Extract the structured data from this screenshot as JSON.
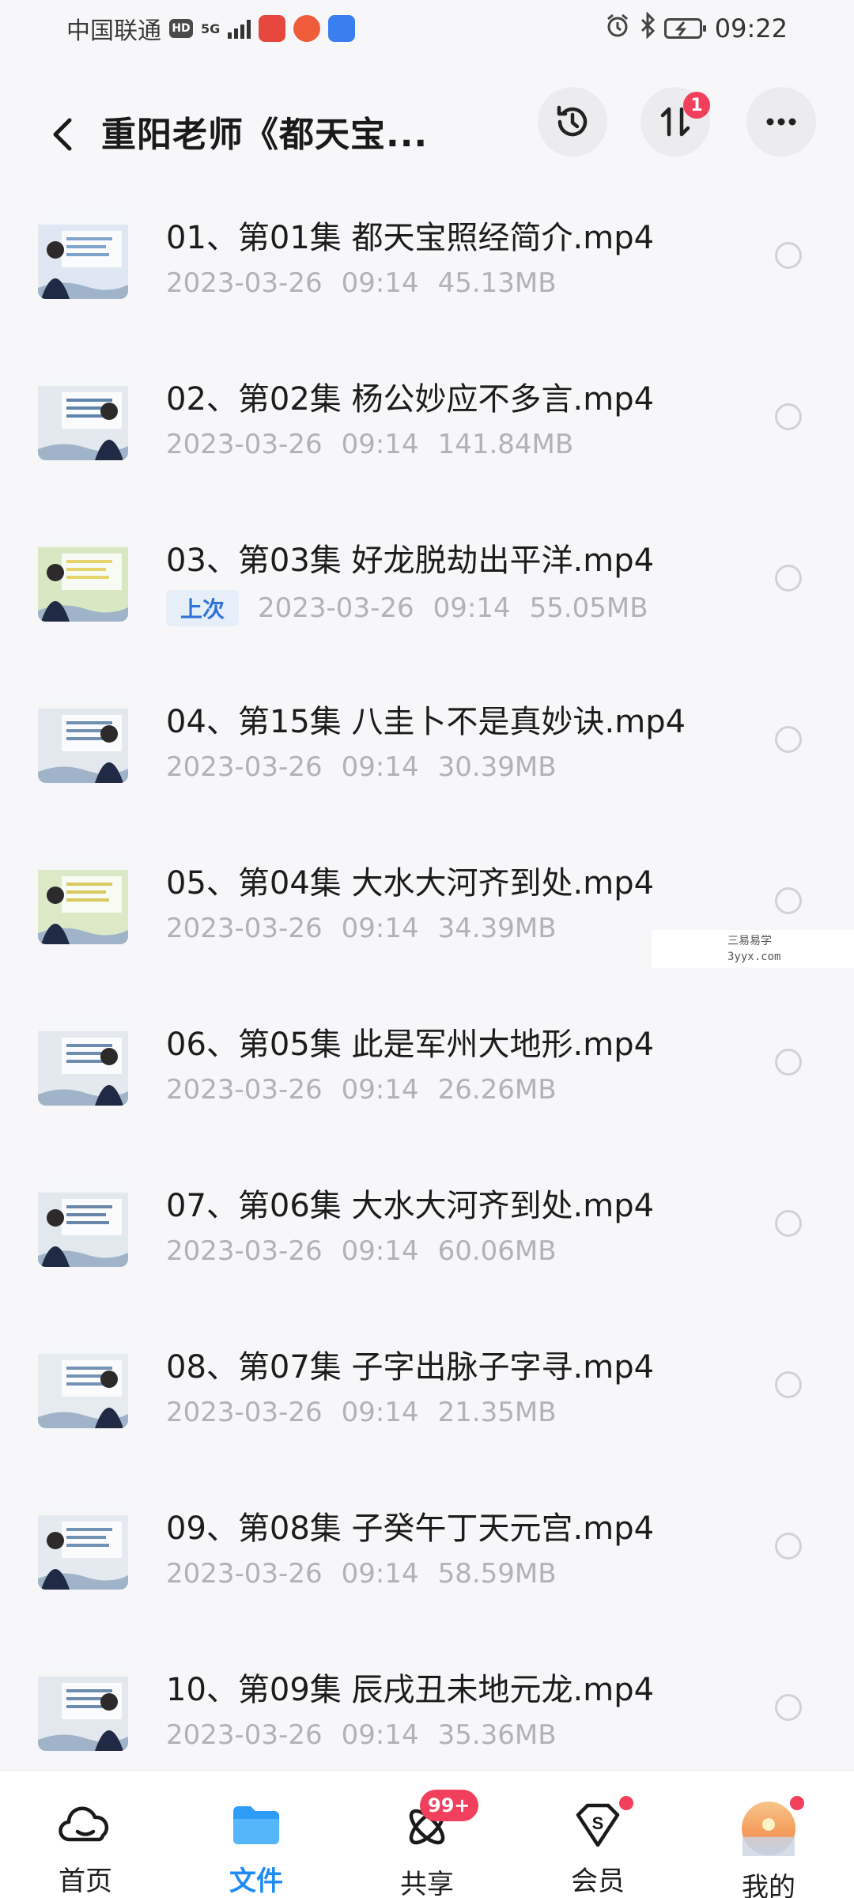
{
  "status_bar": {
    "carrier": "中国联通",
    "hd": "HD",
    "network": "5G",
    "time": "09:22"
  },
  "header": {
    "title": "重阳老师《都天宝...",
    "transfer_badge": "1"
  },
  "files": [
    {
      "name": "01、第01集 都天宝照经简介.mp4",
      "date": "2023-03-26",
      "time": "09:14",
      "size": "45.13MB",
      "tag": ""
    },
    {
      "name": "02、第02集 杨公妙应不多言.mp4",
      "date": "2023-03-26",
      "time": "09:14",
      "size": "141.84MB",
      "tag": ""
    },
    {
      "name": "03、第03集 好龙脱劫出平洋.mp4",
      "date": "2023-03-26",
      "time": "09:14",
      "size": "55.05MB",
      "tag": "上次"
    },
    {
      "name": "04、第15集 八圭卜不是真妙诀.mp4",
      "date": "2023-03-26",
      "time": "09:14",
      "size": "30.39MB",
      "tag": ""
    },
    {
      "name": "05、第04集 大水大河齐到处.mp4",
      "date": "2023-03-26",
      "time": "09:14",
      "size": "34.39MB",
      "tag": ""
    },
    {
      "name": "06、第05集 此是军州大地形.mp4",
      "date": "2023-03-26",
      "time": "09:14",
      "size": "26.26MB",
      "tag": ""
    },
    {
      "name": "07、第06集 大水大河齐到处.mp4",
      "date": "2023-03-26",
      "time": "09:14",
      "size": "60.06MB",
      "tag": ""
    },
    {
      "name": "08、第07集 子字出脉子字寻.mp4",
      "date": "2023-03-26",
      "time": "09:14",
      "size": "21.35MB",
      "tag": ""
    },
    {
      "name": "09、第08集 子癸午丁天元宫.mp4",
      "date": "2023-03-26",
      "time": "09:14",
      "size": "58.59MB",
      "tag": ""
    },
    {
      "name": "10、第09集 辰戌丑未地元龙.mp4",
      "date": "2023-03-26",
      "time": "09:14",
      "size": "35.36MB",
      "tag": ""
    }
  ],
  "watermark": {
    "line1": "三易易学",
    "line2": "3yyx.com"
  },
  "bottom_nav": {
    "items": [
      {
        "label": "首页",
        "icon": "home-cloud-icon"
      },
      {
        "label": "文件",
        "icon": "folder-icon"
      },
      {
        "label": "共享",
        "icon": "share-orbit-icon",
        "badge": "99+"
      },
      {
        "label": "会员",
        "icon": "vip-diamond-icon"
      },
      {
        "label": "我的",
        "icon": "avatar-icon"
      }
    ]
  },
  "colors": {
    "accent": "#1f8cf5",
    "badge": "#f2405c",
    "meta_text": "#b2b2b6"
  }
}
